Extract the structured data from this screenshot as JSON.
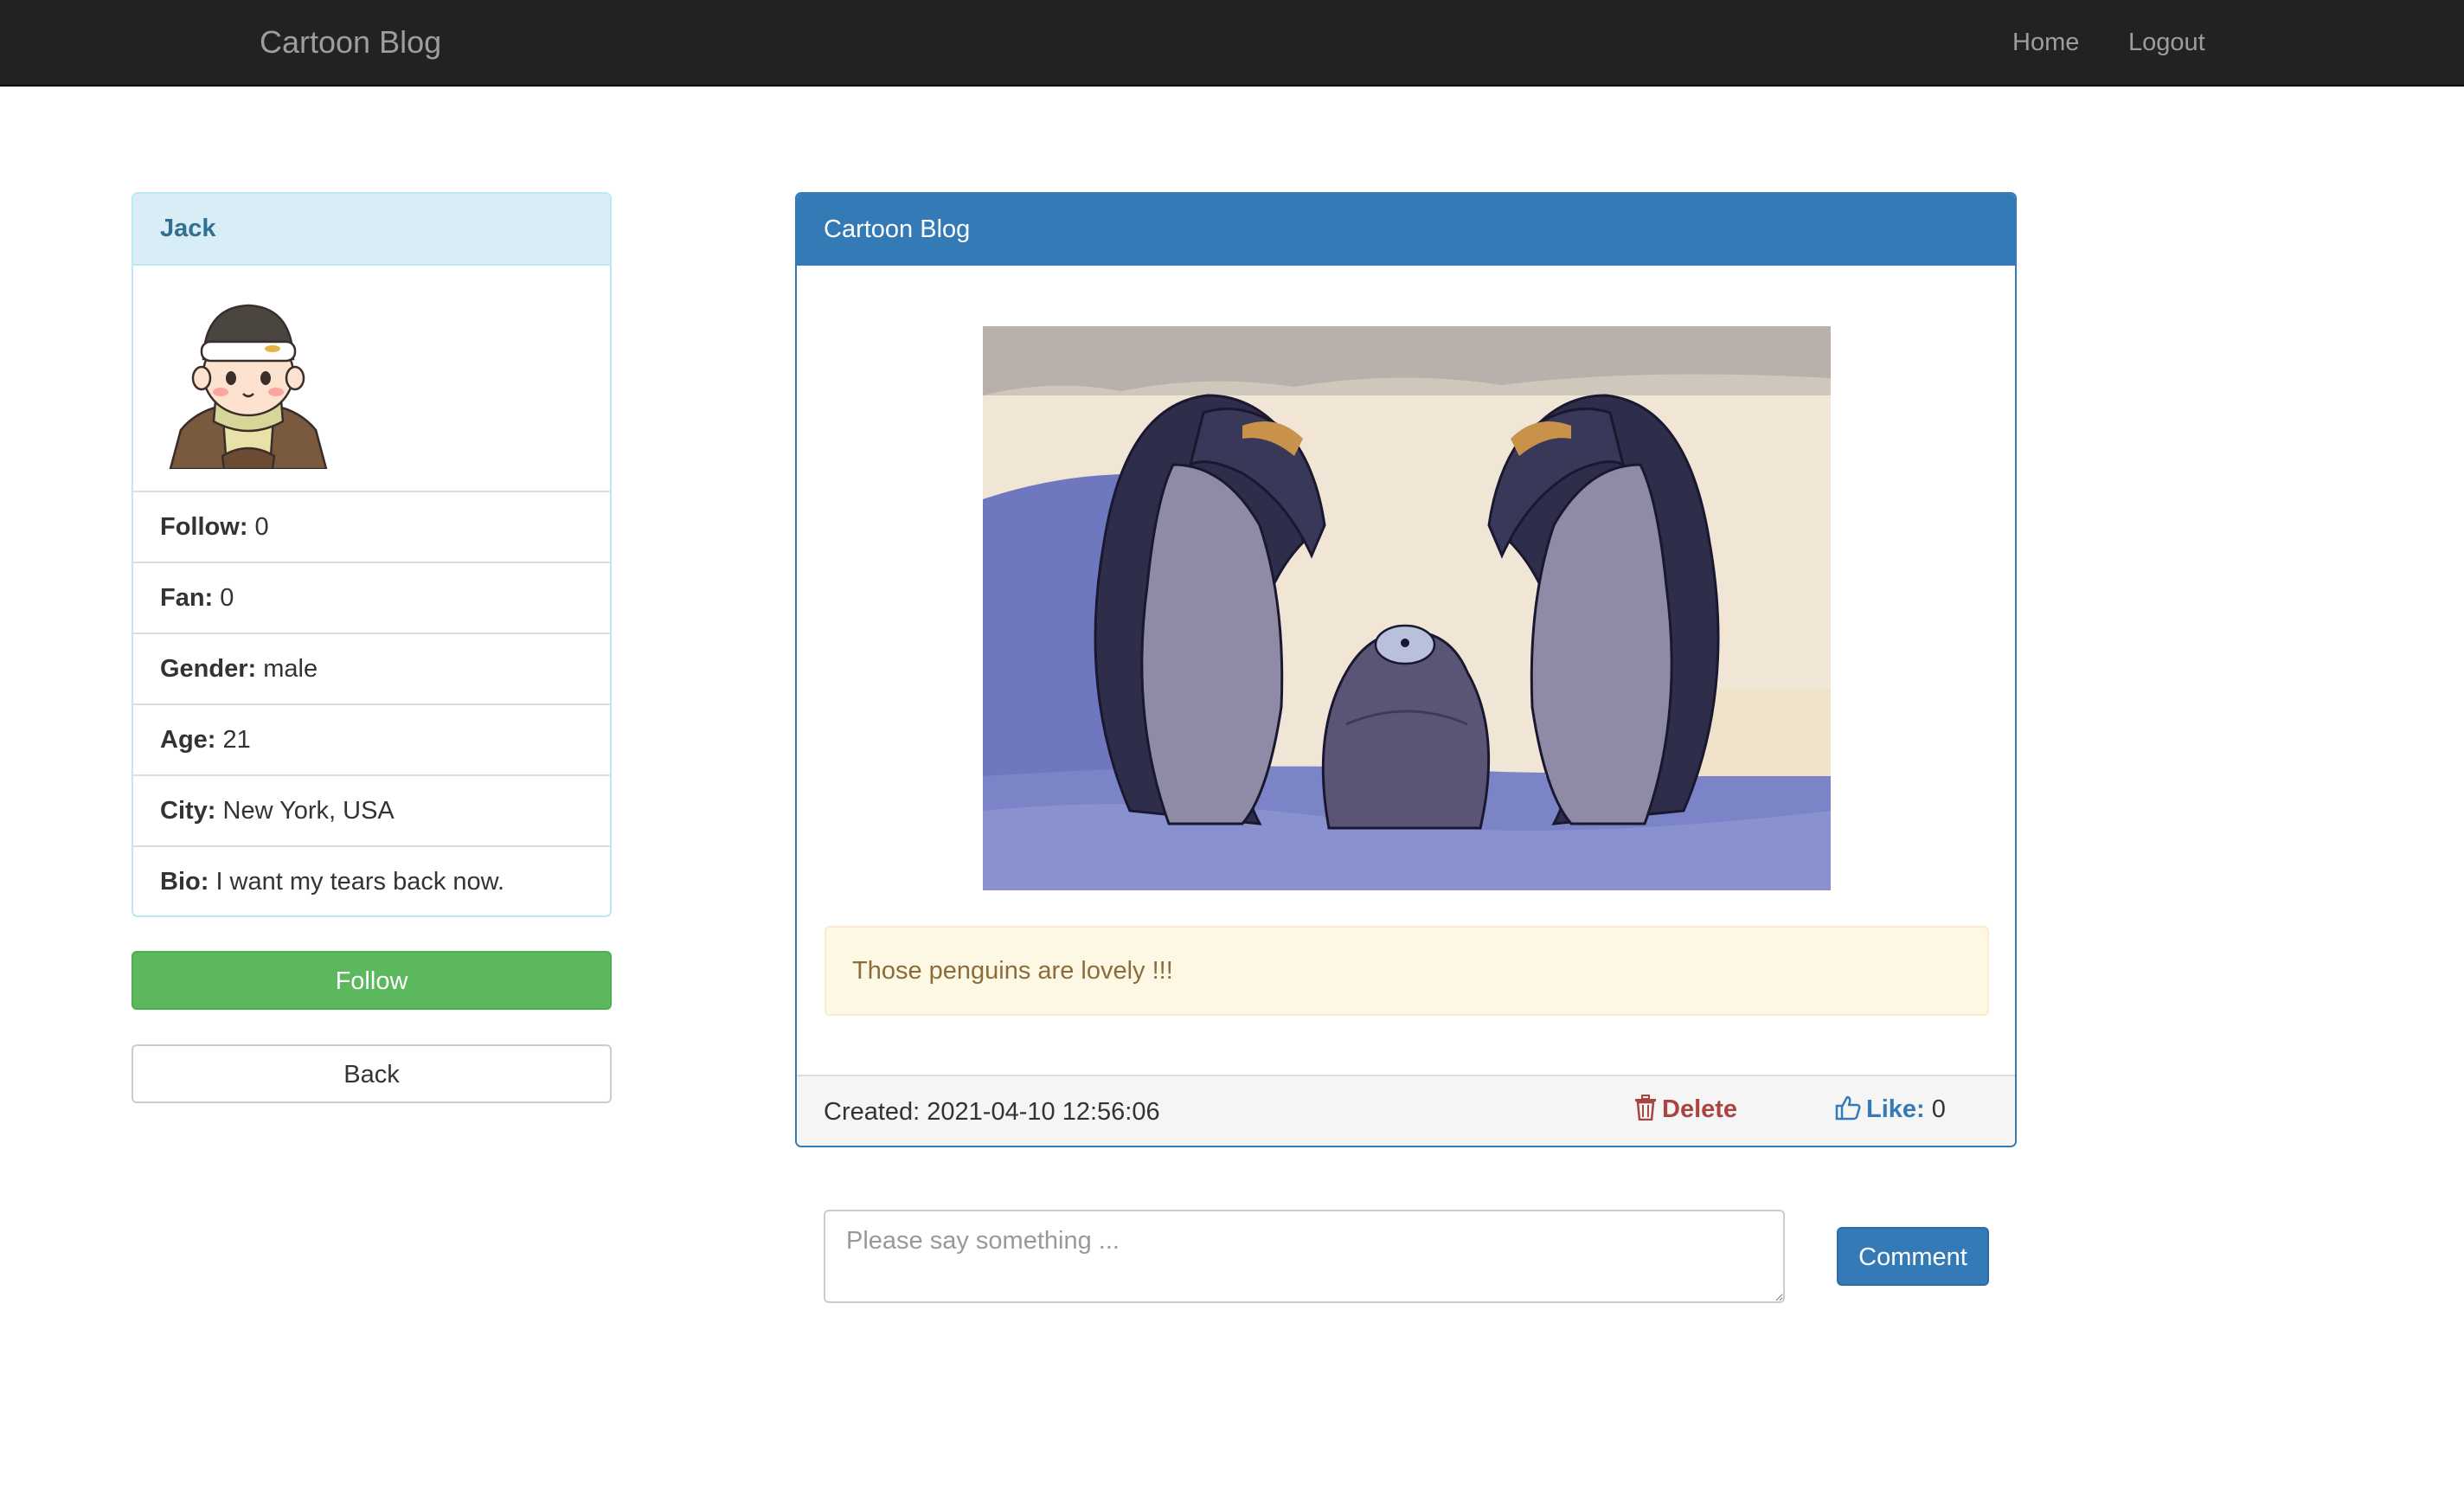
{
  "navbar": {
    "brand": "Cartoon Blog",
    "links": [
      {
        "label": "Home"
      },
      {
        "label": "Logout"
      }
    ]
  },
  "profile": {
    "name": "Jack",
    "avatar_icon": "cartoon-boy-avatar",
    "fields": [
      {
        "label": "Follow:",
        "value": "0"
      },
      {
        "label": "Fan:",
        "value": "0"
      },
      {
        "label": "Gender:",
        "value": "male"
      },
      {
        "label": "Age:",
        "value": "21"
      },
      {
        "label": "City:",
        "value": "New York, USA"
      },
      {
        "label": "Bio:",
        "value": "I want my tears back now."
      }
    ],
    "follow_label": "Follow",
    "back_label": "Back"
  },
  "blog": {
    "title": "Cartoon Blog",
    "image_icon": "penguins-illustration",
    "content": "Those penguins are lovely !!!",
    "created_label": "Created:",
    "created_value": "2021-04-10 12:56:06",
    "delete_label": "Delete",
    "like_label": "Like:",
    "like_count": "0"
  },
  "comment": {
    "placeholder": "Please say something ...",
    "button_label": "Comment"
  },
  "colors": {
    "navbar_bg": "#222222",
    "primary": "#337ab7",
    "success": "#5cb85c",
    "danger": "#a94442",
    "info_heading_bg": "#d9edf7",
    "warning_bg": "#fcf8e3"
  }
}
